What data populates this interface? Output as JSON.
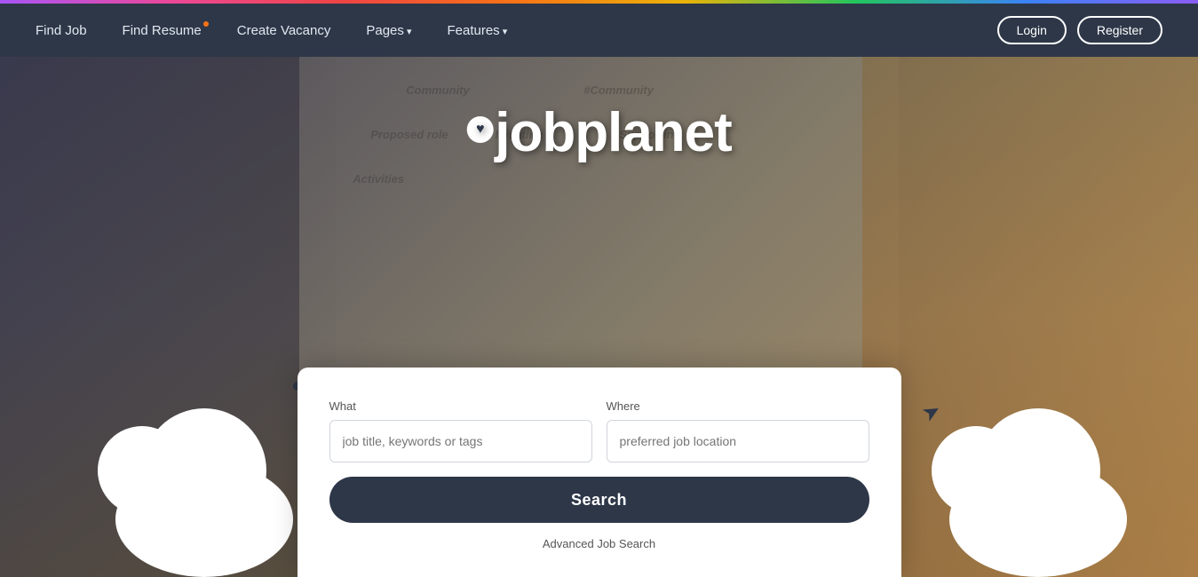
{
  "accent_bar": {},
  "navbar": {
    "items": [
      {
        "label": "Find Job",
        "id": "find-job",
        "has_dot": false,
        "has_arrow": false
      },
      {
        "label": "Find Resume",
        "id": "find-resume",
        "has_dot": true,
        "has_arrow": false
      },
      {
        "label": "Create Vacancy",
        "id": "create-vacancy",
        "has_dot": false,
        "has_arrow": false
      },
      {
        "label": "Pages",
        "id": "pages",
        "has_dot": false,
        "has_arrow": true
      },
      {
        "label": "Features",
        "id": "features",
        "has_dot": false,
        "has_arrow": true
      }
    ],
    "login_label": "Login",
    "register_label": "Register"
  },
  "brand": {
    "name": "jobplanet"
  },
  "search": {
    "what_label": "What",
    "what_placeholder": "job title, keywords or tags",
    "where_label": "Where",
    "where_placeholder": "preferred job location",
    "search_button": "Search",
    "advanced_link": "Advanced Job Search"
  },
  "colors": {
    "navbar_bg": "#2d3748",
    "search_btn_bg": "#2d3748",
    "brand_color": "#ffffff"
  }
}
